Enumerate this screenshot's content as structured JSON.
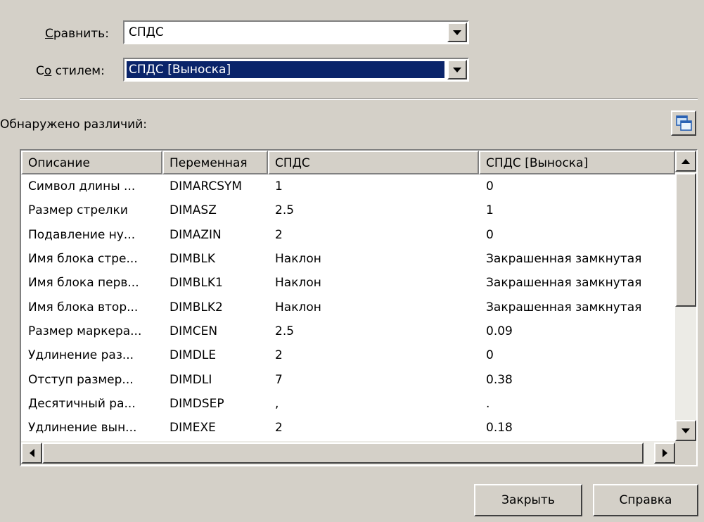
{
  "compare": {
    "label_hotkey": "С",
    "label_rest": "равнить:",
    "value": "СПДС"
  },
  "with_style": {
    "label_pre": "С",
    "label_hotkey": "о",
    "label_rest": " стилем:",
    "value": "СПДС [Выноска]"
  },
  "differences_label": "Обнаружено различий:",
  "table": {
    "columns": [
      "Описание",
      "Переменная",
      "СПДС",
      "СПДС [Выноска]"
    ],
    "rows": [
      [
        "Символ длины ...",
        "DIMARCSYM",
        "1",
        "0"
      ],
      [
        "Размер стрелки",
        "DIMASZ",
        "2.5",
        "1"
      ],
      [
        "Подавление ну...",
        "DIMAZIN",
        "2",
        "0"
      ],
      [
        "Имя блока стре...",
        "DIMBLK",
        "Наклон",
        "Закрашенная замкнутая"
      ],
      [
        "Имя блока перв...",
        "DIMBLK1",
        "Наклон",
        "Закрашенная замкнутая"
      ],
      [
        "Имя блока втор...",
        "DIMBLK2",
        "Наклон",
        "Закрашенная замкнутая"
      ],
      [
        "Размер маркера...",
        "DIMCEN",
        "2.5",
        "0.09"
      ],
      [
        "Удлинение раз...",
        "DIMDLE",
        "2",
        "0"
      ],
      [
        "Отступ размер...",
        "DIMDLI",
        "7",
        "0.38"
      ],
      [
        "Десятичный ра...",
        "DIMDSEP",
        ",",
        "."
      ],
      [
        "Удлинение вын...",
        "DIMEXE",
        "2",
        "0.18"
      ]
    ]
  },
  "buttons": {
    "close": "Закрыть",
    "help": "Справка"
  },
  "colors": {
    "dialog_bg": "#d4d0c8",
    "selection_bg": "#0a246a",
    "selection_fg": "#ffffff"
  },
  "icons": [
    "copy-to-clipboard-icon",
    "chevron-down-icon",
    "arrow-up-icon",
    "arrow-down-icon",
    "arrow-left-icon",
    "arrow-right-icon"
  ]
}
